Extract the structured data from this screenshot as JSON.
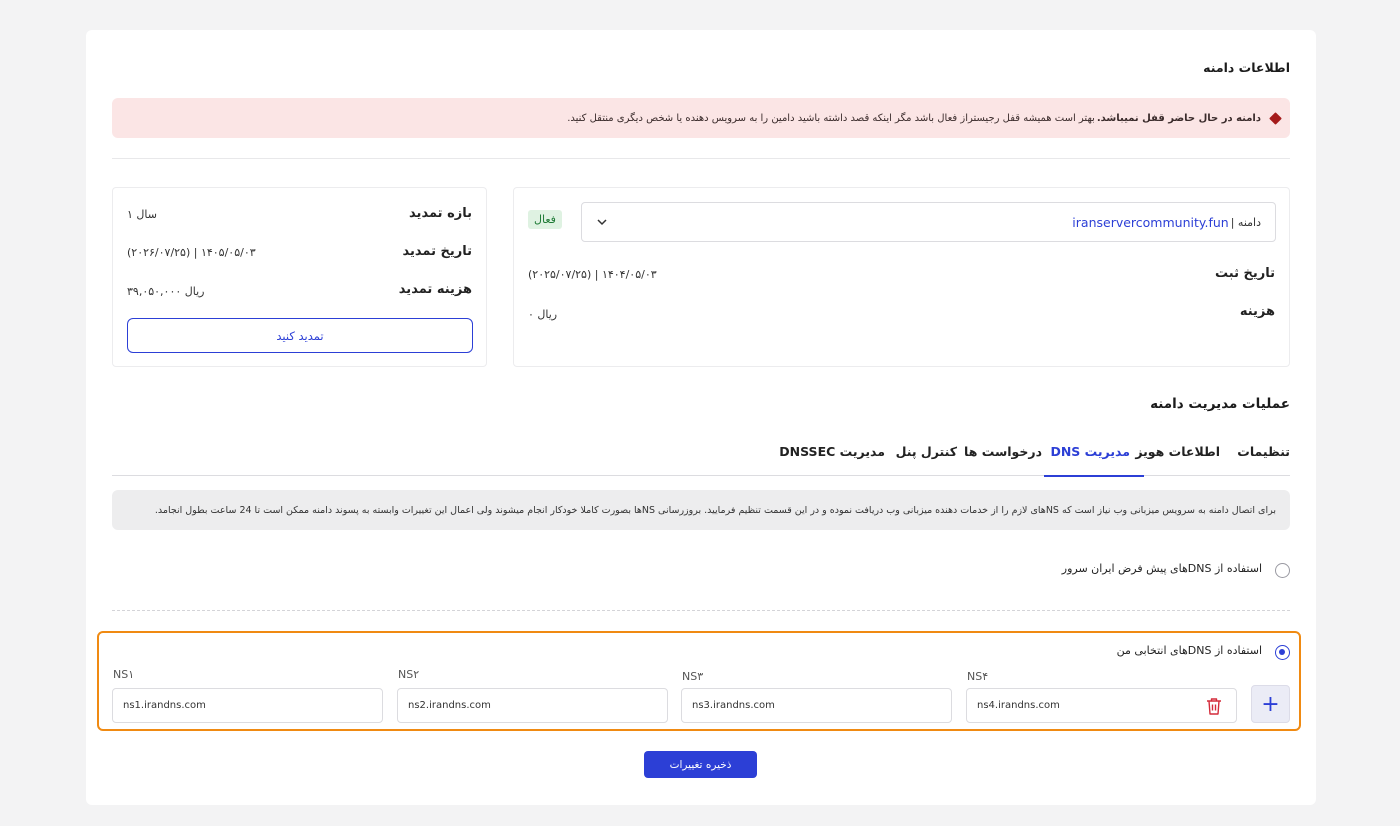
{
  "domain_info": {
    "title": "اطلاعات دامنه",
    "alert_bold": "دامنه در حال حاضر قفل نمیباشد.",
    "alert_text": "بهتر است همیشه قفل رجیستراز فعال باشد مگر اینکه قصد داشته باشید دامین را به سرویس دهنده یا شخص دیگری منتقل کنید.",
    "domain_label": "دامنه |",
    "domain_value": "iranservercommunity.fun",
    "status_badge": "فعال",
    "reg_date_label": "تاریخ ثبت",
    "reg_date_value": "(۲۰۲۵/۰۷/۲۵) | ۱۴۰۴/۰۵/۰۳",
    "cost_label": "هزینه",
    "cost_value": "۰ ریال"
  },
  "renewal": {
    "period_label": "بازه تمدید",
    "period_value": "۱ سال",
    "date_label": "تاریخ تمدید",
    "date_value": "(۲۰۲۶/۰۷/۲۵) | ۱۴۰۵/۰۵/۰۳",
    "cost_label": "هزینه تمدید",
    "cost_value": "۳۹,۰۵۰,۰۰۰ ریال",
    "renew_button": "تمدید کنید"
  },
  "management": {
    "title": "عملیات مدیریت دامنه",
    "tabs": [
      {
        "label": "تنظیمات"
      },
      {
        "label": "اطلاعات هویز"
      },
      {
        "label": "مدیریت DNS"
      },
      {
        "label": "درخواست ها"
      },
      {
        "label": "کنترل پنل"
      },
      {
        "label": "مدیریت DNSSEC"
      }
    ],
    "active_tab": "مدیریت DNS",
    "info_text": "برای اتصال دامنه به سرویس میزبانی وب نیاز است که NSهای لازم را از خدمات دهنده میزبانی وب دریافت نموده و در این قسمت تنظیم فرمایید. بروزرسانی NSها بصورت کاملا خودکار انجام میشوند ولی اعمال این تغییرات وابسته به پسوند دامنه ممکن است تا 24 ساعت بطول انجامد.",
    "option_default": "استفاده از DNSهای پیش فرض ایران سرور",
    "option_custom": "استفاده از DNSهای انتخابی من",
    "selected_option": "custom",
    "nameservers": [
      {
        "label": "NS۱",
        "value": "ns1.irandns.com"
      },
      {
        "label": "NS۲",
        "value": "ns2.irandns.com"
      },
      {
        "label": "NS۳",
        "value": "ns3.irandns.com"
      },
      {
        "label": "NS۴",
        "value": "ns4.irandns.com"
      }
    ],
    "add_button": "+",
    "save_button": "ذخیره تغییرات"
  },
  "colors": {
    "accent": "#2c3fd6",
    "alert_bg": "#fbe5e5",
    "highlight_border": "#f08a12",
    "active_badge_bg": "#dff2e2"
  },
  "icons": {
    "alert": "diamond-alert-icon",
    "dropdown": "chevron-down-icon",
    "delete": "trash-icon"
  }
}
